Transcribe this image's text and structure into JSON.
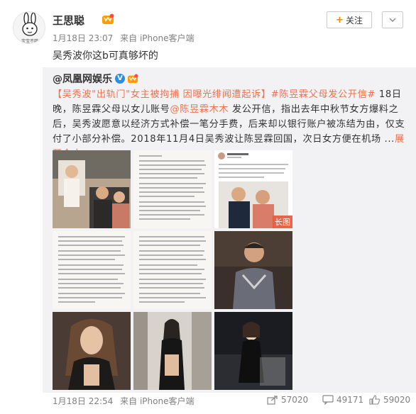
{
  "post": {
    "username": "王思聪",
    "date": "1月18日 23:07",
    "source": "来自 iPhone客户端",
    "text": "吴秀波你这b可真够坏的",
    "follow_label": "关注",
    "avatar_caption": "宝宝不胖"
  },
  "repost": {
    "author": "@凤凰网娱乐",
    "segments": [
      {
        "text": "【吴秀波\"出轨门\"女主被拘捕 因曝光绯闻遭起诉】",
        "type": "link"
      },
      {
        "text": "#陈昱霖父母发公开信#",
        "type": "link"
      },
      {
        "text": " 18日晚，陈昱霖父母以女儿账号",
        "type": "text"
      },
      {
        "text": "@陈昱霖木木",
        "type": "link"
      },
      {
        "text": " 发公开信，指出去年中秋节女方爆料之后，吴秀波愿意以经济方式补偿一笔分手费，后来却以银行账户被冻结为由，仅支付了小部分补偿。2018年11月4日吴秀波让陈昱霖回国，次日女方便在机场 ...",
        "type": "text"
      },
      {
        "text": "展开全文",
        "type": "link"
      },
      {
        "text": "⌄",
        "type": "link"
      }
    ],
    "long_image_tag": "长图",
    "images": [
      {
        "name": "photo-couple-1"
      },
      {
        "name": "letter-scan-1"
      },
      {
        "name": "weibo-screenshot"
      },
      {
        "name": "letter-scan-2"
      },
      {
        "name": "letter-scan-3"
      },
      {
        "name": "photo-actor"
      },
      {
        "name": "photo-woman-1"
      },
      {
        "name": "photo-woman-2"
      },
      {
        "name": "photo-woman-3"
      }
    ],
    "footer": {
      "date": "1月18日 22:54",
      "source": "来自 iPhone客户端",
      "reposts": "57020",
      "comments": "49171",
      "likes": "59020"
    }
  },
  "colors": {
    "link": "#eb7350",
    "accent": "#ff8200",
    "repost_bg": "#f2f2f5",
    "verified_blue": "#2b8ee4"
  }
}
